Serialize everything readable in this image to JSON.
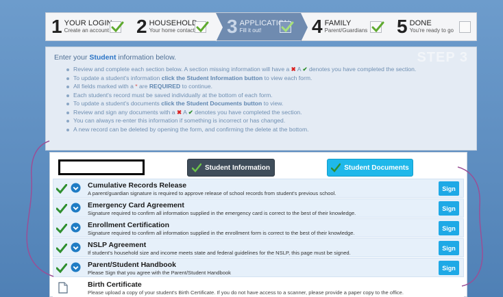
{
  "steps": [
    {
      "num": "1",
      "title": "YOUR LOGIN",
      "sub": "Create an account",
      "done": true
    },
    {
      "num": "2",
      "title": "HOUSEHOLD",
      "sub": "Your home contacts",
      "done": true
    },
    {
      "num": "3",
      "title": "APPLICATION",
      "sub": "Fill it out!",
      "done": true,
      "active": true
    },
    {
      "num": "4",
      "title": "FAMILY",
      "sub": "Parent/Guardians",
      "done": true
    },
    {
      "num": "5",
      "title": "DONE",
      "sub": "You're ready to go",
      "done": false
    }
  ],
  "instructions": {
    "lead_prefix": "Enter your ",
    "lead_bold": "Student",
    "lead_suffix": " information below.",
    "step_label": "STEP 3",
    "items": [
      {
        "pre": "Review and complete each section below. A section missing information will have a ",
        "mid": " A ",
        "post": " denotes you have completed the section."
      },
      {
        "pre": "To update a student's information ",
        "bold": "click the Student Information button",
        "post": " to view each form."
      },
      {
        "pre": "All fields marked with a ",
        "req": "*",
        "mid": " are ",
        "bold": "REQUIRED",
        "post": " to continue."
      },
      {
        "pre": "Each student's record must be saved individually at the bottom of each form."
      },
      {
        "pre": "To update a student's documents ",
        "bold": "click the Student Documents button",
        "post": " to view."
      },
      {
        "pre": "Review and sign any documents with a ",
        "mid": " A ",
        "post": " denotes you have completed the section."
      },
      {
        "pre": "You can always re-enter this information if something is incorrect or has changed."
      },
      {
        "pre": "A new record can be deleted by opening the form, and confirming the delete at the bottom."
      }
    ]
  },
  "buttons": {
    "student_info": "Student Information",
    "student_docs": "Student Documents",
    "sign": "Sign"
  },
  "documents": [
    {
      "title": "Cumulative Records Release",
      "desc": "A parent/guardian signature is required to approve release of school records from student's previous school.",
      "signed": true
    },
    {
      "title": "Emergency Card Agreement",
      "desc": "Signature required to confirm all information supplied in the emergency card is correct to the best of their knowledge.",
      "signed": true
    },
    {
      "title": "Enrollment Certification",
      "desc": "Signature required to confirm all information supplied in the enrollment form is correct to the best of their knowledge.",
      "signed": true
    },
    {
      "title": "NSLP Agreement",
      "desc": "If student's household size and income meets state and federal guidelines for the NSLP, this page must be signed.",
      "signed": true
    },
    {
      "title": "Parent/Student Handbook",
      "desc": "Please Sign that you agree with the Parent/Student Handbook",
      "signed": true
    },
    {
      "title": "Birth Certificate",
      "desc": "Please upload a copy of your student's Birth Certificate. If you do not have access to a scanner, please provide a paper copy to the office.",
      "upload": true
    }
  ],
  "colors": {
    "accent": "#1ea9e6",
    "check_green": "#2f8f2f",
    "error_red": "#d92020",
    "background": "#5f8fc0"
  }
}
